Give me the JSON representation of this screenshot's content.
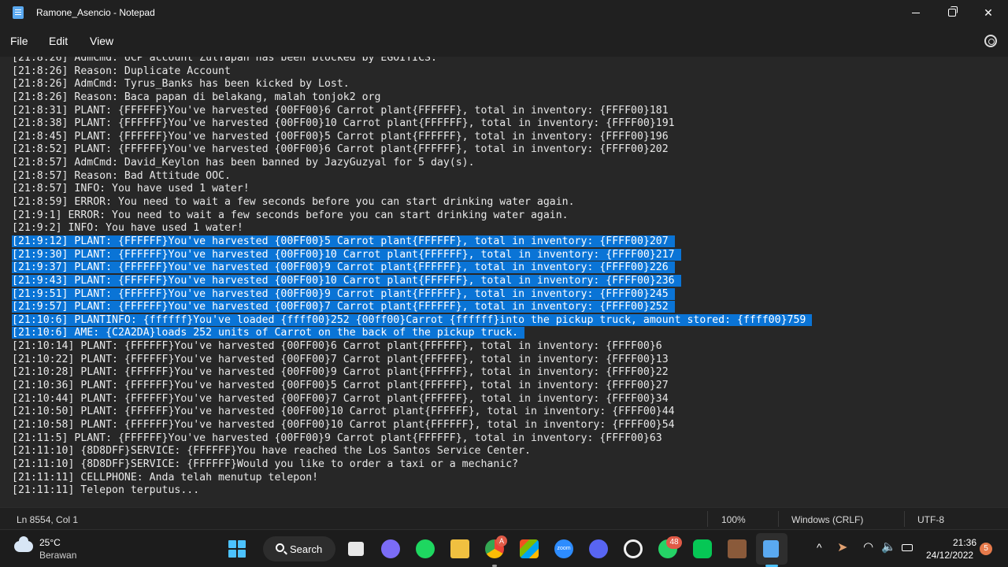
{
  "window": {
    "title": "Ramone_Asencio - Notepad"
  },
  "menu": {
    "file": "File",
    "edit": "Edit",
    "view": "View"
  },
  "editor": {
    "lines": [
      "[21:8:26] AdmCmd: UCP account ZulYapan has been blocked by EGOITICS.",
      "[21:8:26] Reason: Duplicate Account",
      "[21:8:26] AdmCmd: Tyrus_Banks has been kicked by Lost.",
      "[21:8:26] Reason: Baca papan di belakang, malah tonjok2 org",
      "[21:8:31] PLANT: {FFFFFF}You've harvested {00FF00}6 Carrot plant{FFFFFF}, total in inventory: {FFFF00}181",
      "[21:8:38] PLANT: {FFFFFF}You've harvested {00FF00}10 Carrot plant{FFFFFF}, total in inventory: {FFFF00}191",
      "[21:8:45] PLANT: {FFFFFF}You've harvested {00FF00}5 Carrot plant{FFFFFF}, total in inventory: {FFFF00}196",
      "[21:8:52] PLANT: {FFFFFF}You've harvested {00FF00}6 Carrot plant{FFFFFF}, total in inventory: {FFFF00}202",
      "[21:8:57] AdmCmd: David_Keylon has been banned by JazyGuzyal for 5 day(s).",
      "[21:8:57] Reason: Bad Attitude OOC.",
      "[21:8:57] INFO: You have used 1 water!",
      "[21:8:59] ERROR: You need to wait a few seconds before you can start drinking water again.",
      "[21:9:1] ERROR: You need to wait a few seconds before you can start drinking water again.",
      "[21:9:2] INFO: You have used 1 water!",
      "[21:9:12] PLANT: {FFFFFF}You've harvested {00FF00}5 Carrot plant{FFFFFF}, total in inventory: {FFFF00}207 ",
      "[21:9:30] PLANT: {FFFFFF}You've harvested {00FF00}10 Carrot plant{FFFFFF}, total in inventory: {FFFF00}217 ",
      "[21:9:37] PLANT: {FFFFFF}You've harvested {00FF00}9 Carrot plant{FFFFFF}, total in inventory: {FFFF00}226 ",
      "[21:9:43] PLANT: {FFFFFF}You've harvested {00FF00}10 Carrot plant{FFFFFF}, total in inventory: {FFFF00}236 ",
      "[21:9:51] PLANT: {FFFFFF}You've harvested {00FF00}9 Carrot plant{FFFFFF}, total in inventory: {FFFF00}245 ",
      "[21:9:57] PLANT: {FFFFFF}You've harvested {00FF00}7 Carrot plant{FFFFFF}, total in inventory: {FFFF00}252 ",
      "[21:10:6] PLANTINFO: {ffffff}You've loaded {ffff00}252 {00ff00}Carrot {ffffff}into the pickup truck, amount stored: {ffff00}759 ",
      "[21:10:6] AME: {C2A2DA}loads 252 units of Carrot on the back of the pickup truck. ",
      "[21:10:14] PLANT: {FFFFFF}You've harvested {00FF00}6 Carrot plant{FFFFFF}, total in inventory: {FFFF00}6",
      "[21:10:22] PLANT: {FFFFFF}You've harvested {00FF00}7 Carrot plant{FFFFFF}, total in inventory: {FFFF00}13",
      "[21:10:28] PLANT: {FFFFFF}You've harvested {00FF00}9 Carrot plant{FFFFFF}, total in inventory: {FFFF00}22",
      "[21:10:36] PLANT: {FFFFFF}You've harvested {00FF00}5 Carrot plant{FFFFFF}, total in inventory: {FFFF00}27",
      "[21:10:44] PLANT: {FFFFFF}You've harvested {00FF00}7 Carrot plant{FFFFFF}, total in inventory: {FFFF00}34",
      "[21:10:50] PLANT: {FFFFFF}You've harvested {00FF00}10 Carrot plant{FFFFFF}, total in inventory: {FFFF00}44",
      "[21:10:58] PLANT: {FFFFFF}You've harvested {00FF00}10 Carrot plant{FFFFFF}, total in inventory: {FFFF00}54",
      "[21:11:5] PLANT: {FFFFFF}You've harvested {00FF00}9 Carrot plant{FFFFFF}, total in inventory: {FFFF00}63",
      "[21:11:10] {8D8DFF}SERVICE: {FFFFFF}You have reached the Los Santos Service Center.",
      "[21:11:10] {8D8DFF}SERVICE: {FFFFFF}Would you like to order a taxi or a mechanic?",
      "[21:11:11] CELLPHONE: Anda telah menutup telepon!",
      "[21:11:11] Telepon terputus..."
    ],
    "selected_start": 14,
    "selected_end": 21
  },
  "status": {
    "position": "Ln 8554, Col 1",
    "zoom": "100%",
    "line_ending": "Windows (CRLF)",
    "encoding": "UTF-8"
  },
  "taskbar": {
    "weather_temp": "25°C",
    "weather_desc": "Berawan",
    "search_label": "Search",
    "chrome_badge": "A",
    "whatsapp_badge": "48",
    "zoom_label": "zoom",
    "time": "21:36",
    "date": "24/12/2022",
    "notification_count": "5"
  },
  "colors": {
    "background": "#202020",
    "editor_bg": "#272727",
    "selection": "#0a74d6",
    "accent": "#4cc2ff"
  }
}
